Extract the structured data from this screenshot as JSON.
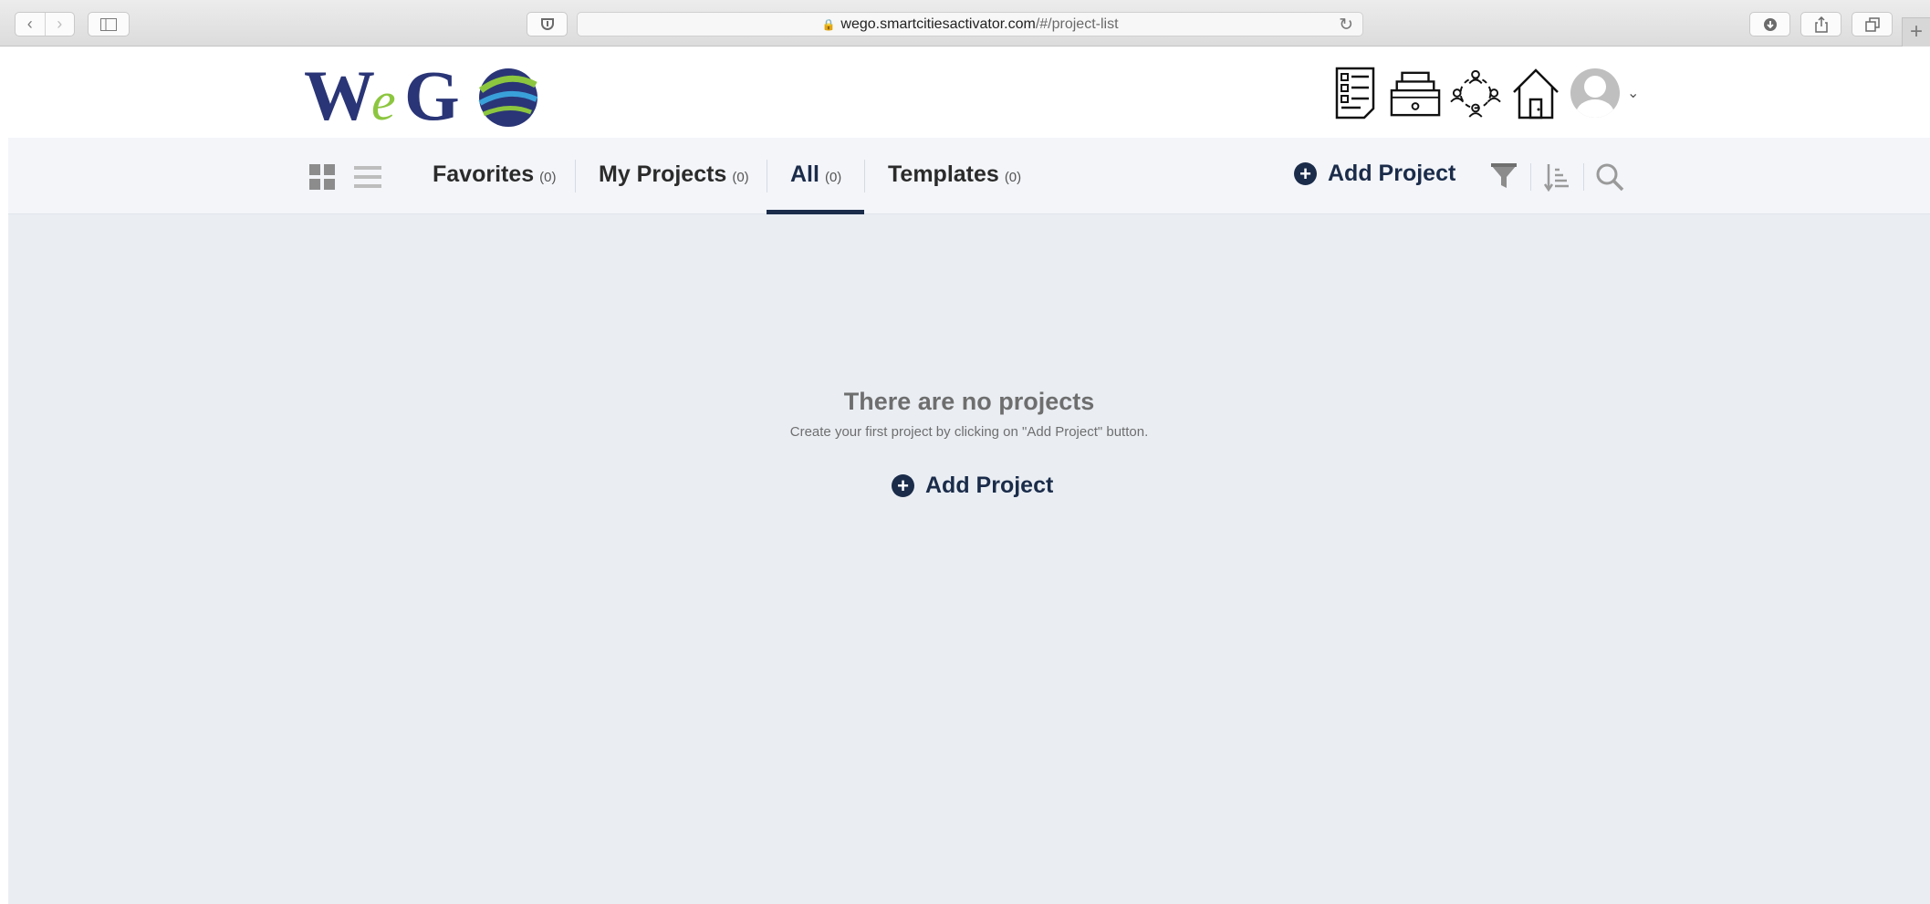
{
  "browser": {
    "url_host": "wego.smartcitiesactivator.com",
    "url_path": "/#/project-list"
  },
  "header": {
    "logo_text": "WeGO",
    "icons": [
      "document-list-icon",
      "inbox-tray-icon",
      "people-network-icon",
      "home-icon",
      "user-avatar-icon"
    ]
  },
  "nav": {
    "tabs": [
      {
        "label": "Favorites",
        "count": "(0)"
      },
      {
        "label": "My Projects",
        "count": "(0)"
      },
      {
        "label": "All",
        "count": "(0)",
        "active": true
      },
      {
        "label": "Templates",
        "count": "(0)"
      }
    ],
    "add_project_label": "Add Project"
  },
  "empty_state": {
    "title": "There are no projects",
    "subtitle": "Create your first project by clicking on \"Add Project\" button.",
    "button_label": "Add Project"
  },
  "colors": {
    "accent": "#1b2c4a",
    "content_bg": "#eaeef3",
    "nav_bg": "#f3f5f9"
  }
}
